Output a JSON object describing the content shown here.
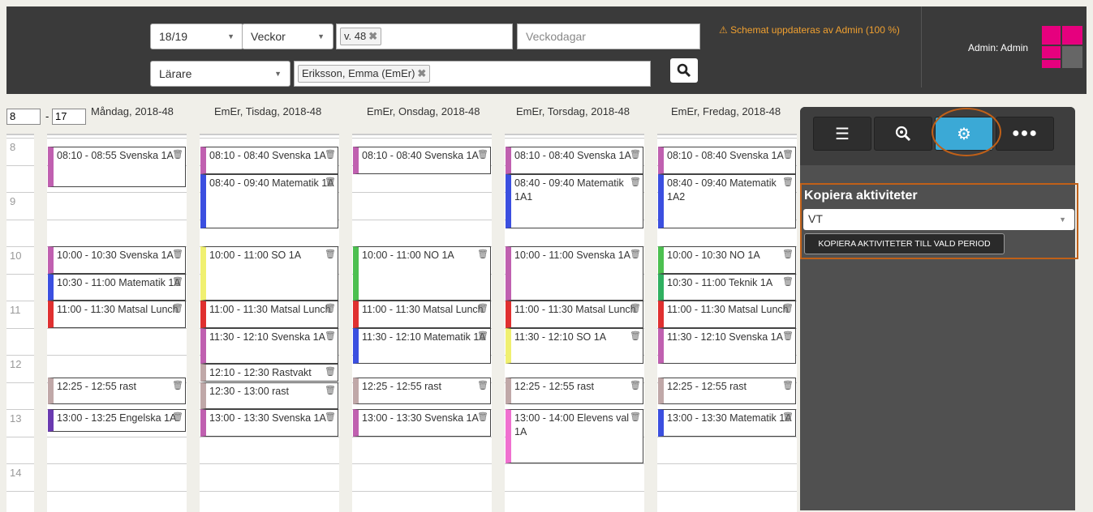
{
  "header": {
    "year": "18/19",
    "period_type": "Veckor",
    "week_tag": "v. 48",
    "weekdays_placeholder": "Veckodagar",
    "role": "Lärare",
    "person_tag": "Eriksson, Emma (EmEr)",
    "warning": "⚠ Schemat uppdateras av Admin (100 %)",
    "user": "Admin: Admin"
  },
  "calendar": {
    "start_hour": "8",
    "end_hour": "17",
    "days": [
      "Måndag, 2018-48",
      "EmEr, Tisdag, 2018-48",
      "EmEr, Onsdag, 2018-48",
      "EmEr, Torsdag, 2018-48",
      "EmEr, Fredag, 2018-48"
    ],
    "hours": [
      "8",
      "9",
      "10",
      "11",
      "12",
      "13",
      "14"
    ],
    "events": {
      "mon": [
        {
          "text": "08:10 - 08:55 Svenska 1A",
          "color": "#c060b0"
        },
        {
          "text": "10:00 - 10:30 Svenska 1A",
          "color": "#c060b0"
        },
        {
          "text": "10:30 - 11:00 Matematik 1A",
          "color": "#3b4fe0"
        },
        {
          "text": "11:00 - 11:30 Matsal Lunch",
          "color": "#e03030"
        },
        {
          "text": "12:25 - 12:55 rast",
          "color": "#c0a8a8"
        },
        {
          "text": "13:00 - 13:25 Engelska 1A",
          "color": "#6a3ab0"
        }
      ],
      "tue": [
        {
          "text": "08:10 - 08:40 Svenska 1A",
          "color": "#c060b0"
        },
        {
          "text": "08:40 - 09:40 Matematik 1A",
          "color": "#3b4fe0"
        },
        {
          "text": "10:00 - 11:00 SO 1A",
          "color": "#f0f070"
        },
        {
          "text": "11:00 - 11:30 Matsal Lunch",
          "color": "#e03030"
        },
        {
          "text": "11:30 - 12:10 Svenska 1A",
          "color": "#c060b0"
        },
        {
          "text": "12:10 - 12:30 Rastvakt",
          "color": "#c0a8a8"
        },
        {
          "text": "12:30 - 13:00 rast",
          "color": "#c0a8a8"
        },
        {
          "text": "13:00 - 13:30 Svenska 1A",
          "color": "#c060b0"
        }
      ],
      "wed": [
        {
          "text": "08:10 - 08:40 Svenska 1A",
          "color": "#c060b0"
        },
        {
          "text": "10:00 - 11:00 NO 1A",
          "color": "#4cc050"
        },
        {
          "text": "11:00 - 11:30 Matsal Lunch",
          "color": "#e03030"
        },
        {
          "text": "11:30 - 12:10 Matematik 1A",
          "color": "#3b4fe0"
        },
        {
          "text": "12:25 - 12:55 rast",
          "color": "#c0a8a8"
        },
        {
          "text": "13:00 - 13:30 Svenska 1A",
          "color": "#c060b0"
        }
      ],
      "thu": [
        {
          "text": "08:10 - 08:40 Svenska 1A",
          "color": "#c060b0"
        },
        {
          "text": "08:40 - 09:40 Matematik 1A1",
          "color": "#3b4fe0"
        },
        {
          "text": "10:00 - 11:00 Svenska 1A",
          "color": "#c060b0"
        },
        {
          "text": "11:00 - 11:30 Matsal Lunch",
          "color": "#e03030"
        },
        {
          "text": "11:30 - 12:10 SO 1A",
          "color": "#f0f070"
        },
        {
          "text": "12:25 - 12:55 rast",
          "color": "#c0a8a8"
        },
        {
          "text": "13:00 - 14:00 Elevens val 1A",
          "color": "#f070d0"
        }
      ],
      "fri": [
        {
          "text": "08:10 - 08:40 Svenska 1A",
          "color": "#c060b0"
        },
        {
          "text": "08:40 - 09:40 Matematik 1A2",
          "color": "#3b4fe0"
        },
        {
          "text": "10:00 - 10:30 NO 1A",
          "color": "#4cc050"
        },
        {
          "text": "10:30 - 11:00 Teknik 1A",
          "color": "#30b060"
        },
        {
          "text": "11:00 - 11:30 Matsal Lunch",
          "color": "#e03030"
        },
        {
          "text": "11:30 - 12:10 Svenska 1A",
          "color": "#c060b0"
        },
        {
          "text": "12:25 - 12:55 rast",
          "color": "#c0a8a8"
        },
        {
          "text": "13:00 - 13:30 Matematik 1A",
          "color": "#3b4fe0"
        }
      ]
    }
  },
  "side": {
    "title": "Kopiera aktiviteter",
    "select_value": "VT",
    "button": "KOPIERA AKTIVITETER TILL VALD PERIOD"
  },
  "icons": [
    "list-icon",
    "zoom-icon",
    "gear-icon",
    "more-icon",
    "search-icon",
    "trash-icon"
  ]
}
